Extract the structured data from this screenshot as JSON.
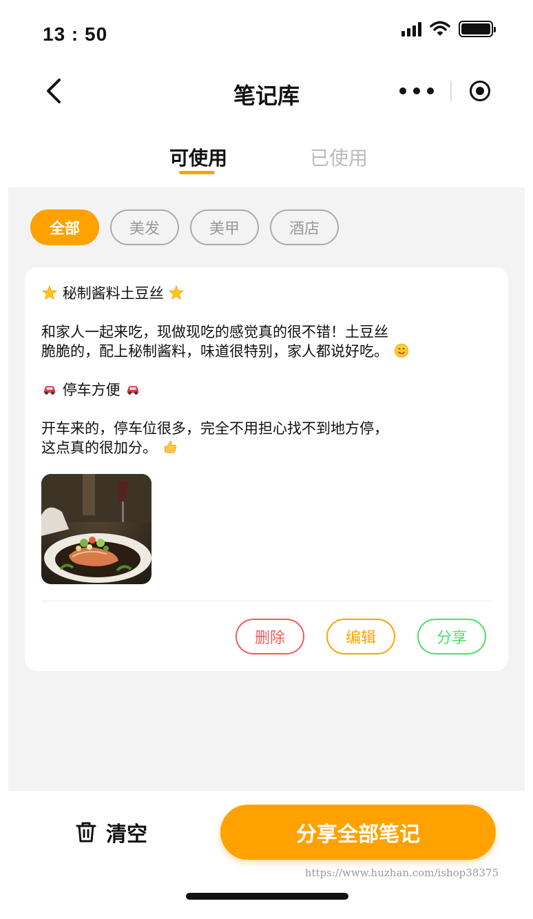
{
  "status_bar": {
    "time": "13 : 50"
  },
  "nav": {
    "title": "笔记库"
  },
  "tabs": [
    {
      "label": "可使用",
      "active": true
    },
    {
      "label": "已使用",
      "active": false
    }
  ],
  "filters": [
    {
      "label": "全部",
      "active": true
    },
    {
      "label": "美发",
      "active": false
    },
    {
      "label": "美甲",
      "active": false
    },
    {
      "label": "酒店",
      "active": false
    }
  ],
  "note": {
    "title": "秘制酱料土豆丝",
    "paragraph1_line1": "和家人一起来吃，现做现吃的感觉真的很不错！土豆丝",
    "paragraph1_line2": "脆脆的，配上秘制酱料，味道很特别，家人都说好吃。",
    "subtitle": "停车方便",
    "paragraph2_line1": "开车来的，停车位很多，完全不用担心找不到地方停，",
    "paragraph2_line2": "这点真的很加分。",
    "actions": {
      "delete": "删除",
      "edit": "编辑",
      "share": "分享"
    }
  },
  "bottom": {
    "clear_label": "清空",
    "share_all_label": "分享全部笔记"
  },
  "watermark": "https://www.huzhan.com/ishop38375",
  "colors": {
    "accent": "#ffa200",
    "delete": "#f25a5a",
    "share": "#4de060"
  }
}
